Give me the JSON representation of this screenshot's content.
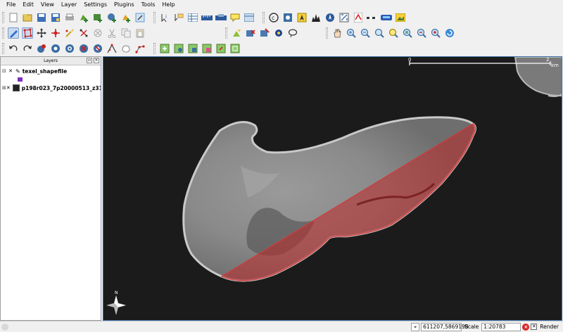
{
  "menu": [
    "File",
    "Edit",
    "View",
    "Layer",
    "Settings",
    "Plugins",
    "Tools",
    "Help"
  ],
  "toolbar1": {
    "file_group": [
      "new-project-icon",
      "open-project-icon",
      "save-project-icon",
      "save-as-icon",
      "print-icon",
      "add-vector-layer-icon",
      "add-raster-layer-icon",
      "add-postgis-layer-icon",
      "new-vector-layer-icon",
      "remove-layer-icon"
    ],
    "view_group": [
      "identify-icon",
      "map-tips-icon",
      "attribute-table-icon",
      "measure-line-icon",
      "measure-area-icon",
      "annotation-icon",
      "open-table-icon"
    ],
    "plugin_group": [
      "copyright-label-icon",
      "gps-icon",
      "north-arrow-icon",
      "histogram-icon",
      "compass-icon",
      "georeferencer-icon",
      "pdf-icon",
      "scale-bar-icon",
      "grass-icon",
      "image-icon"
    ]
  },
  "toolbar2": {
    "digitize_group": [
      "toggle-editing-icon",
      "capture-polygon-icon",
      "move-feature-icon",
      "node-tool-icon",
      "split-features-icon",
      "delete-selected-icon",
      "delete-icon",
      "cut-features-icon",
      "copy-features-icon",
      "paste-features-icon"
    ],
    "select_group": [
      "add-point-icon",
      "add-line-icon",
      "select-features-icon",
      "settings-gear-icon",
      "lasso-icon"
    ],
    "nav_group": [
      "pan-icon",
      "zoom-in-icon",
      "zoom-out-icon",
      "zoom-full-icon",
      "zoom-selection-icon",
      "zoom-layer-icon",
      "zoom-last-icon",
      "zoom-actual-icon",
      "refresh-icon"
    ]
  },
  "toolbar3": {
    "advanced_group": [
      "undo-icon",
      "redo-icon",
      "simplify-icon",
      "add-ring-icon",
      "add-island-icon",
      "delete-ring-icon",
      "delete-part-icon",
      "reshape-icon",
      "split-icon",
      "merge-icon"
    ],
    "label_group": [
      "label-icon",
      "label-pin-icon",
      "label-show-icon",
      "label-move-icon",
      "label-rotate-icon",
      "label-change-icon"
    ]
  },
  "layers_panel": {
    "title": "Layers",
    "items": [
      {
        "name": "texel_shapefile",
        "checked": "✕",
        "expanded": "⊟"
      },
      {
        "name": "p198r023_7p20000513_z31...",
        "checked": "✕",
        "expanded": "⊞"
      }
    ]
  },
  "map": {
    "scale_bar_start": "0",
    "scale_bar_end": "2",
    "scale_bar_unit": "km",
    "background_color": "#1b1b1b",
    "selection_color": "#c0282a"
  },
  "statusbar": {
    "coordinates": "611207,5869198",
    "scale_label": "Scale",
    "scale_value": "1:20783",
    "render_label": "Render",
    "render_checked": "✕"
  }
}
